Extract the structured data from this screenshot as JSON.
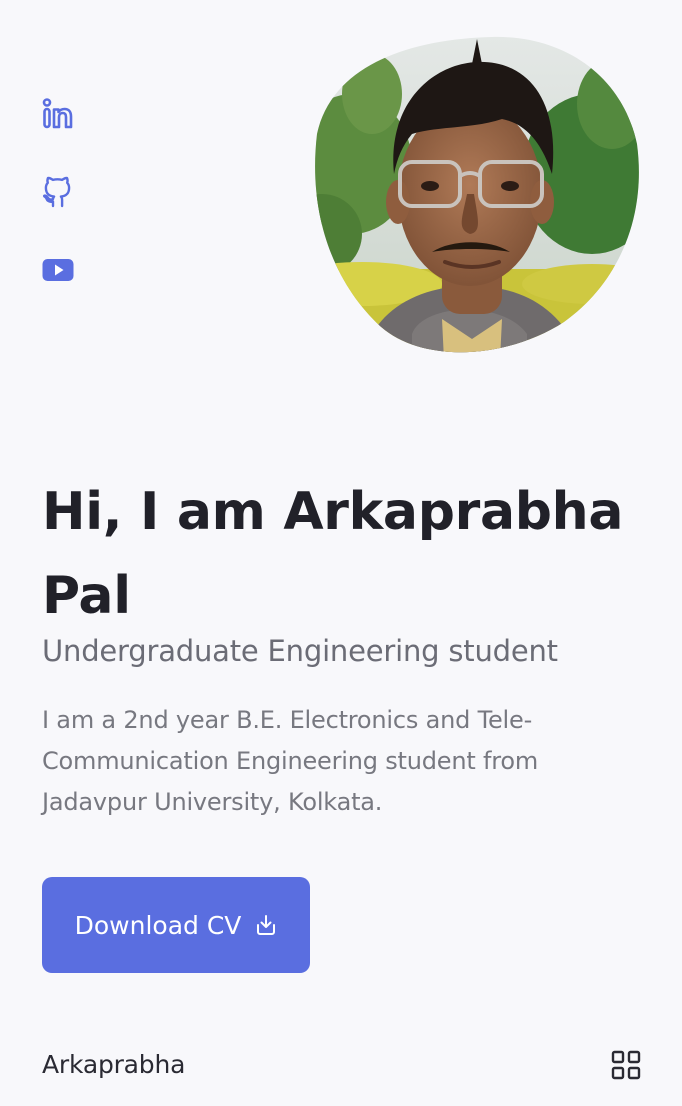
{
  "social": {
    "icons": [
      "linkedin-icon",
      "github-icon",
      "youtube-icon"
    ]
  },
  "hero": {
    "title": "Hi, I am Arkaprabha Pal",
    "subtitle": "Undergraduate Engineering student",
    "description": "I am a 2nd year B.E. Electronics and Tele-Communication Engineering student from Jadavpur University, Kolkata.",
    "button_label": "Download CV",
    "button_icon": "download-icon"
  },
  "footer": {
    "name": "Arkaprabha",
    "menu_icon": "grid-menu-icon"
  },
  "colors": {
    "accent": "#5a6ee0",
    "background": "#f8f8fb",
    "title": "#212129",
    "muted": "#6b6c76"
  }
}
